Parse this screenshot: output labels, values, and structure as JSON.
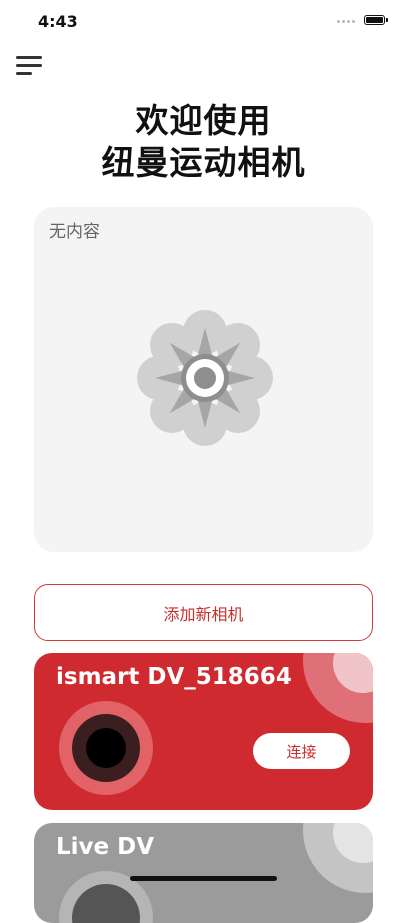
{
  "status_bar": {
    "time": "4:43"
  },
  "header": {
    "title_line1": "欢迎使用",
    "title_line2": "纽曼运动相机",
    "menu_icon": "hamburger-menu-icon"
  },
  "empty_state": {
    "label": "无内容",
    "icon": "flower-placeholder-icon"
  },
  "add_camera": {
    "label": "添加新相机"
  },
  "cameras": [
    {
      "name": "ismart DV_518664",
      "action": "连接",
      "color": "#cf2a2f"
    },
    {
      "name": "Live DV",
      "color": "#9b9b9b"
    }
  ],
  "colors": {
    "accent": "#cf2a2f",
    "card_bg": "#f4f4f4"
  }
}
